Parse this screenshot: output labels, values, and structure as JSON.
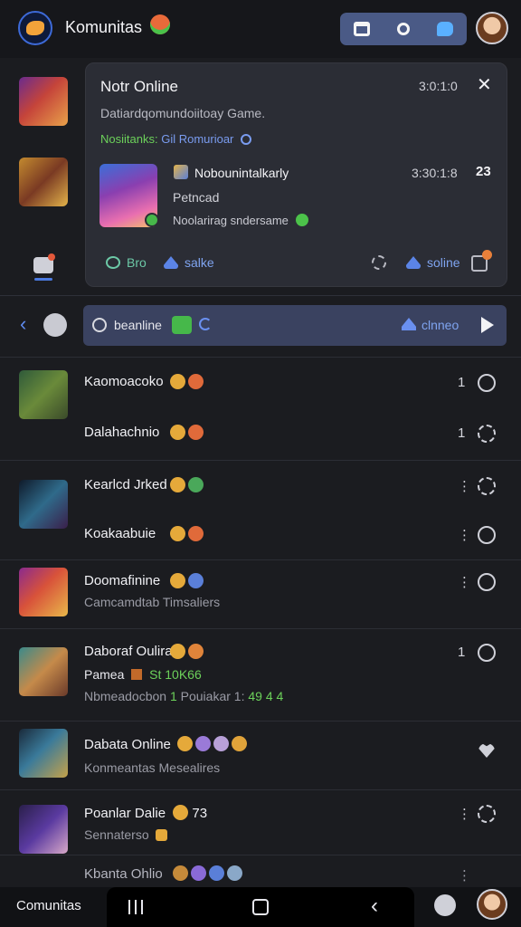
{
  "header": {
    "title": "Komunitas",
    "logo_icon": "community-logo-icon",
    "title_emoji": "smiling-face-icon",
    "actions": [
      "calendar-icon",
      "search-icon",
      "chat-icon"
    ]
  },
  "notification": {
    "title": "Notr Online",
    "time": "3:0:1:0",
    "description": "Datiardqomundoiitoay Game.",
    "meta_green": "Nosiitanks:",
    "meta_blue": "Gil Romurioar",
    "game": {
      "title": "Nobounintalkarly",
      "time": "3:30:1:8",
      "count": "23",
      "subtitle": "Petncad",
      "status": "Noolarirag sndersame"
    },
    "actions": {
      "bro": "Bro",
      "salke": "salke",
      "online": "soline"
    }
  },
  "filter_bar": {
    "label": "beanline",
    "online_label": "clnneo"
  },
  "feed": [
    {
      "title": "Kaomoacoko",
      "subtitle": "",
      "count": "1"
    },
    {
      "title": "Dalahachnio",
      "subtitle": "",
      "count": "1"
    },
    {
      "title": "Kearlcd Jrked",
      "subtitle": "",
      "count": "⋮"
    },
    {
      "title": "Koakaabuie",
      "subtitle": "",
      "count": "⋮"
    },
    {
      "title": "Doomafinine",
      "subtitle": "Camcamdtab Timsaliers",
      "count": "⋮"
    },
    {
      "title": "Daboraf Oulira",
      "subtitle": "Pamea",
      "subtitle_green": "St 10K66",
      "subtitle2": "Nbmeadocbon",
      "subtitle2_green": "1",
      "subtitle2_rest": "Pouiakar 1:",
      "subtitle2_tail": "49 4 4",
      "count": "1"
    },
    {
      "title": "Dabata Online",
      "subtitle": "Konmeantas Mesealires",
      "count": ""
    },
    {
      "title": "Poanlar Dalie",
      "title_badge": "73",
      "subtitle": "Sennaterso",
      "count": "⋮"
    },
    {
      "title": "Kbanta Ohlio",
      "subtitle": "",
      "count": "⋮"
    }
  ],
  "bottom": {
    "label": "Comunitas"
  },
  "colors": {
    "background": "#1b1c20",
    "card": "#2b2d35",
    "accent_blue": "#5f8cf0",
    "accent_green": "#4cc24a",
    "filter_bar": "#3a4260"
  }
}
